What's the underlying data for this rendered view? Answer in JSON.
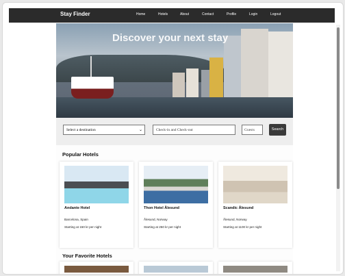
{
  "nav": {
    "brand": "Stay Finder",
    "links": [
      "Home",
      "Hotels",
      "About",
      "Contact",
      "Profile",
      "Login",
      "Logout"
    ]
  },
  "hero": {
    "title": "Discover your next stay"
  },
  "search": {
    "destination_value": "Select a destination",
    "dates_placeholder": "Check-in and Check-out",
    "guests_placeholder": "Guests",
    "button_label": "Search"
  },
  "popular": {
    "title": "Popular Hotels",
    "hotels": [
      {
        "name": "Andante Hotel",
        "location": "Barcelona, Spain",
        "price": "Starting at 150 kr per night"
      },
      {
        "name": "Thon Hotel Ålesund",
        "location": "Ålesund, Norway",
        "price": "Starting at 250 kr per night"
      },
      {
        "name": "Scandic Ålesund",
        "location": "Ålesund, Norway",
        "price": "Starting at 1100 kr per night"
      }
    ]
  },
  "favorites": {
    "title": "Your Favorite Hotels"
  },
  "colors": {
    "navbar": "#2b2b2b",
    "button": "#3a3a3a"
  }
}
